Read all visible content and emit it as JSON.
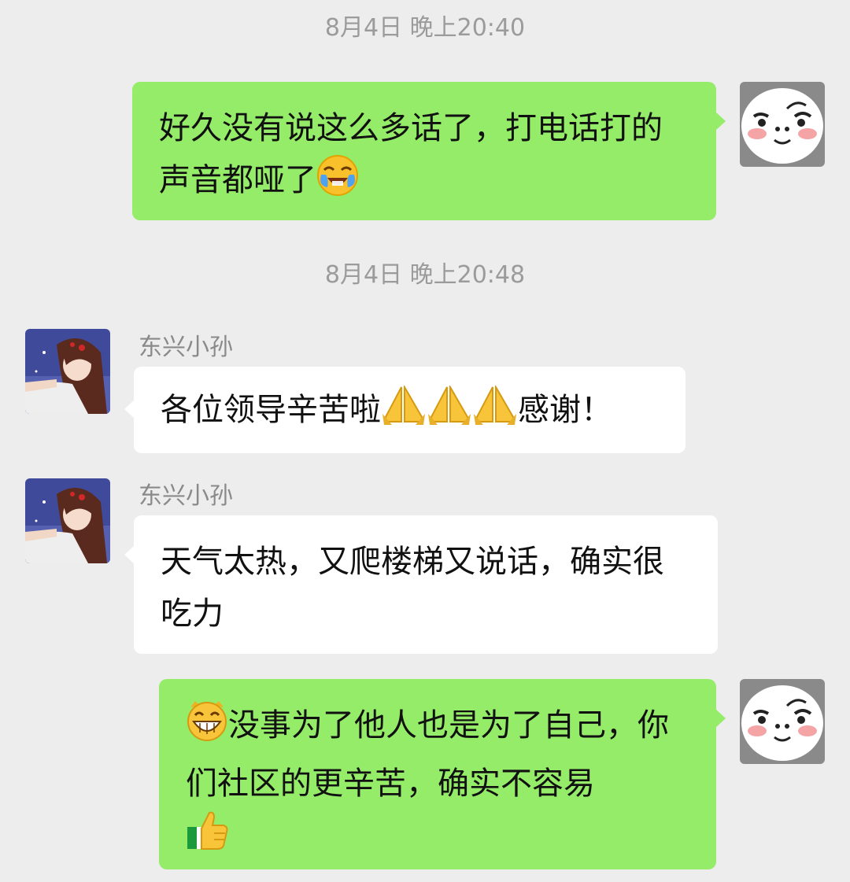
{
  "chat": {
    "messages": [
      {
        "timestamp": "8月4日 晚上20:40",
        "side": "self",
        "text_parts": [
          "好久没有说这么多话了，打电话打的声音都哑了",
          ""
        ],
        "emojis": [
          "face-with-tears-of-joy-emoji"
        ]
      },
      {
        "timestamp": "8月4日 晚上20:48"
      },
      {
        "side": "other",
        "sender": "东兴小孙",
        "text_parts": [
          "各位领导辛苦啦",
          "感谢！"
        ],
        "emojis": [
          "folded-hands-emoji",
          "folded-hands-emoji",
          "folded-hands-emoji"
        ]
      },
      {
        "side": "other",
        "sender": "东兴小孙",
        "text": "天气太热，又爬楼梯又说话，确实很吃力"
      },
      {
        "side": "self",
        "text_parts": [
          "",
          "没事为了他人也是为了自己，你们社区的更辛苦，确实不容易"
        ],
        "emojis": [
          "grinning-face-emoji",
          "thumbs-up-emoji"
        ]
      }
    ]
  },
  "colors": {
    "background": "#ededed",
    "self_bubble": "#95ec69",
    "other_bubble": "#ffffff",
    "timestamp_text": "#9b9b9b",
    "sender_name": "#8a8a8a"
  }
}
